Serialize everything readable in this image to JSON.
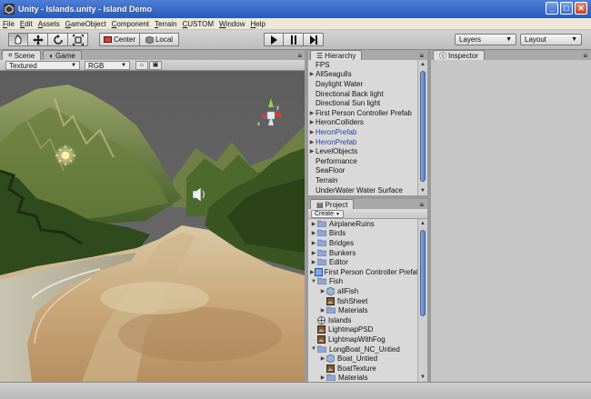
{
  "window": {
    "title": "Unity - Islands.unity - Island Demo",
    "min_label": "_",
    "max_label": "□",
    "close_label": "✕"
  },
  "menu": [
    "File",
    "Edit",
    "Assets",
    "GameObject",
    "Component",
    "Terrain",
    "CUSTOM",
    "Window",
    "Help"
  ],
  "toolbar": {
    "pivot_label": "Center",
    "space_label": "Local",
    "layers_label": "Layers",
    "layout_label": "Layout",
    "transform_tools": [
      "hand-icon",
      "move-icon",
      "rotate-icon",
      "scale-icon"
    ],
    "play_controls": [
      "play-icon",
      "pause-icon",
      "step-icon"
    ]
  },
  "scene": {
    "tab_scene": "Scene",
    "tab_game": "Game",
    "render_mode": "Textured",
    "color_mode": "RGB"
  },
  "hierarchy": {
    "tab": "Hierarchy",
    "items": [
      {
        "label": "FPS",
        "arrow": false,
        "prefab": false
      },
      {
        "label": "AllSeagulls",
        "arrow": true,
        "prefab": false
      },
      {
        "label": "Daylight Water",
        "arrow": false,
        "prefab": false
      },
      {
        "label": "Directional Back light",
        "arrow": false,
        "prefab": false
      },
      {
        "label": "Directional Sun light",
        "arrow": false,
        "prefab": false
      },
      {
        "label": "First Person Controller Prefab",
        "arrow": true,
        "prefab": false
      },
      {
        "label": "HeronColliders",
        "arrow": true,
        "prefab": false
      },
      {
        "label": "HeronPrefab",
        "arrow": true,
        "prefab": true
      },
      {
        "label": "HeronPrefab",
        "arrow": true,
        "prefab": true
      },
      {
        "label": "LevelObjects",
        "arrow": true,
        "prefab": false
      },
      {
        "label": "Performance",
        "arrow": false,
        "prefab": false
      },
      {
        "label": "SeaFloor",
        "arrow": false,
        "prefab": false
      },
      {
        "label": "Terrain",
        "arrow": false,
        "prefab": false
      },
      {
        "label": "UnderWater Water Surface",
        "arrow": false,
        "prefab": false
      }
    ]
  },
  "project": {
    "tab": "Project",
    "create_label": "Create",
    "items": [
      {
        "label": "AirplaneRuins",
        "indent": 0,
        "arrow": "right",
        "icon": "folder"
      },
      {
        "label": "Birds",
        "indent": 0,
        "arrow": "right",
        "icon": "folder"
      },
      {
        "label": "Bridges",
        "indent": 0,
        "arrow": "right",
        "icon": "folder"
      },
      {
        "label": "Bunkers",
        "indent": 0,
        "arrow": "right",
        "icon": "folder"
      },
      {
        "label": "Editor",
        "indent": 0,
        "arrow": "right",
        "icon": "folder"
      },
      {
        "label": "First Person Controller Prefab",
        "indent": 0,
        "arrow": "right",
        "icon": "prefab"
      },
      {
        "label": "Fish",
        "indent": 0,
        "arrow": "down",
        "icon": "folder"
      },
      {
        "label": "allFish",
        "indent": 1,
        "arrow": "right",
        "icon": "model"
      },
      {
        "label": "fishSheet",
        "indent": 1,
        "arrow": "none",
        "icon": "texture"
      },
      {
        "label": "Materials",
        "indent": 1,
        "arrow": "right",
        "icon": "folder"
      },
      {
        "label": "Islands",
        "indent": 0,
        "arrow": "none",
        "icon": "scene"
      },
      {
        "label": "LightmapPSD",
        "indent": 0,
        "arrow": "none",
        "icon": "texture"
      },
      {
        "label": "LightmapWithFog",
        "indent": 0,
        "arrow": "none",
        "icon": "texture"
      },
      {
        "label": "LongBoat_NC_Untied",
        "indent": 0,
        "arrow": "down",
        "icon": "folder"
      },
      {
        "label": "Boat_Untied",
        "indent": 1,
        "arrow": "right",
        "icon": "model"
      },
      {
        "label": "BoatTexture",
        "indent": 1,
        "arrow": "none",
        "icon": "texture"
      },
      {
        "label": "Materials",
        "indent": 1,
        "arrow": "right",
        "icon": "folder"
      }
    ]
  },
  "inspector": {
    "tab": "Inspector"
  }
}
